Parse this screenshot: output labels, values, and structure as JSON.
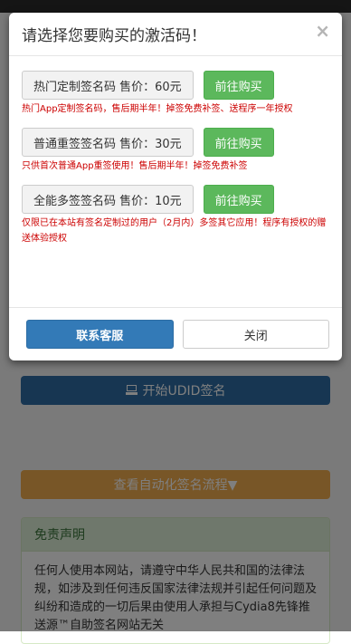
{
  "background": {
    "udid_button_label": "开始UDID签名",
    "flow_button_label": "查看自动化签名流程▼",
    "disclaimer": {
      "heading": "免责声明",
      "text": "任何人使用本网站，请遵守中华人民共和国的法律法规，如涉及到任何违反国家法律法规并引起任何问题及纠纷和造成的一切后果由使用人承担与Cydia8先锋推送源™自助签名网站无关"
    }
  },
  "modal": {
    "title": "请选择您要购买的激活码！",
    "close_label": "×",
    "items": [
      {
        "price_label": "热门定制签名码 售价：60元",
        "buy_label": "前往购买",
        "note": "热门App定制签名码，售后期半年！掉签免费补签、送程序一年授权"
      },
      {
        "price_label": "普通重签签名码 售价：30元",
        "buy_label": "前往购买",
        "note": "只供首次普通App重签使用！售后期半年！掉签免费补签"
      },
      {
        "price_label": "全能多签签名码 售价：10元",
        "buy_label": "前往购买",
        "note": "仅限已在本站有签名定制过的用户（2月内）多签其它应用！程序有授权的赠送体验授权"
      }
    ],
    "footer": {
      "contact_label": "联系客服",
      "close_label": "关闭"
    }
  },
  "colors": {
    "primary": "#337ab7",
    "success": "#5cb85c",
    "warning": "#f0ad4e",
    "note_red": "#cc0000"
  }
}
